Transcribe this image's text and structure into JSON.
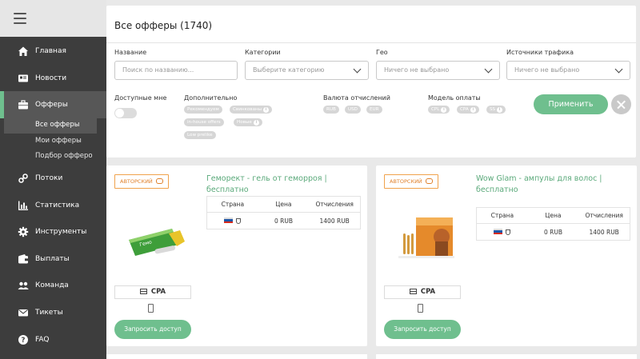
{
  "sidebar": {
    "items": [
      {
        "label": "Главная",
        "icon": "home-icon"
      },
      {
        "label": "Новости",
        "icon": "news-icon"
      },
      {
        "label": "Офферы",
        "icon": "briefcase-icon"
      },
      {
        "label": "Потоки",
        "icon": "link-icon"
      },
      {
        "label": "Статистика",
        "icon": "bar-chart-icon"
      },
      {
        "label": "Инструменты",
        "icon": "gear-icon"
      },
      {
        "label": "Выплаты",
        "icon": "wallet-icon"
      },
      {
        "label": "Команда",
        "icon": "team-icon"
      },
      {
        "label": "Тикеты",
        "icon": "mail-icon"
      },
      {
        "label": "FAQ",
        "icon": "question-icon"
      }
    ],
    "submenu": [
      "Все офферы",
      "Мои офферы",
      "Подбор офферо"
    ]
  },
  "filters": {
    "title": "Все офферы (1740)",
    "name_label": "Название",
    "name_placeholder": "Поиск по названию...",
    "category_label": "Категории",
    "category_value": "Выберите категорию",
    "geo_label": "Гео",
    "geo_value": "Ничего не выбрано",
    "traffic_label": "Источники трафика",
    "traffic_value": "Ничего не выбрано",
    "available_label": "Доступные мне",
    "extra_label": "Дополнительно",
    "extra_chips": [
      "Рекомендуем",
      "Свинкованы",
      "in-house offers",
      "Новые",
      "Low prelike"
    ],
    "currency_label": "Валюта отчислений",
    "currency_chips": [
      "RUB",
      "USD",
      "EUR"
    ],
    "payment_label": "Модель оплаты",
    "payment_chips": [
      "CPL",
      "CPA",
      "SS"
    ],
    "apply_label": "Применить"
  },
  "cards": [
    {
      "badge": "АВТОРСКИЙ",
      "title": "Геморект - гель от геморроя | бесплатно",
      "th_country": "Страна",
      "th_price": "Цена",
      "th_payout": "Отчисления",
      "price": "0 RUB",
      "payout": "1400 RUB",
      "type": "CPA",
      "button": "Запросить доступ"
    },
    {
      "badge": "АВТОРСКИЙ",
      "title": "Wow Glam - ампулы для волос | бесплатно",
      "th_country": "Страна",
      "th_price": "Цена",
      "th_payout": "Отчисления",
      "price": "0 RUB",
      "payout": "1400 RUB",
      "type": "CPA",
      "button": "Запросить доступ"
    }
  ],
  "colors": {
    "accent": "#6fbf8e",
    "sidebar": "#3d3d3d",
    "badge": "#f0a24c"
  }
}
